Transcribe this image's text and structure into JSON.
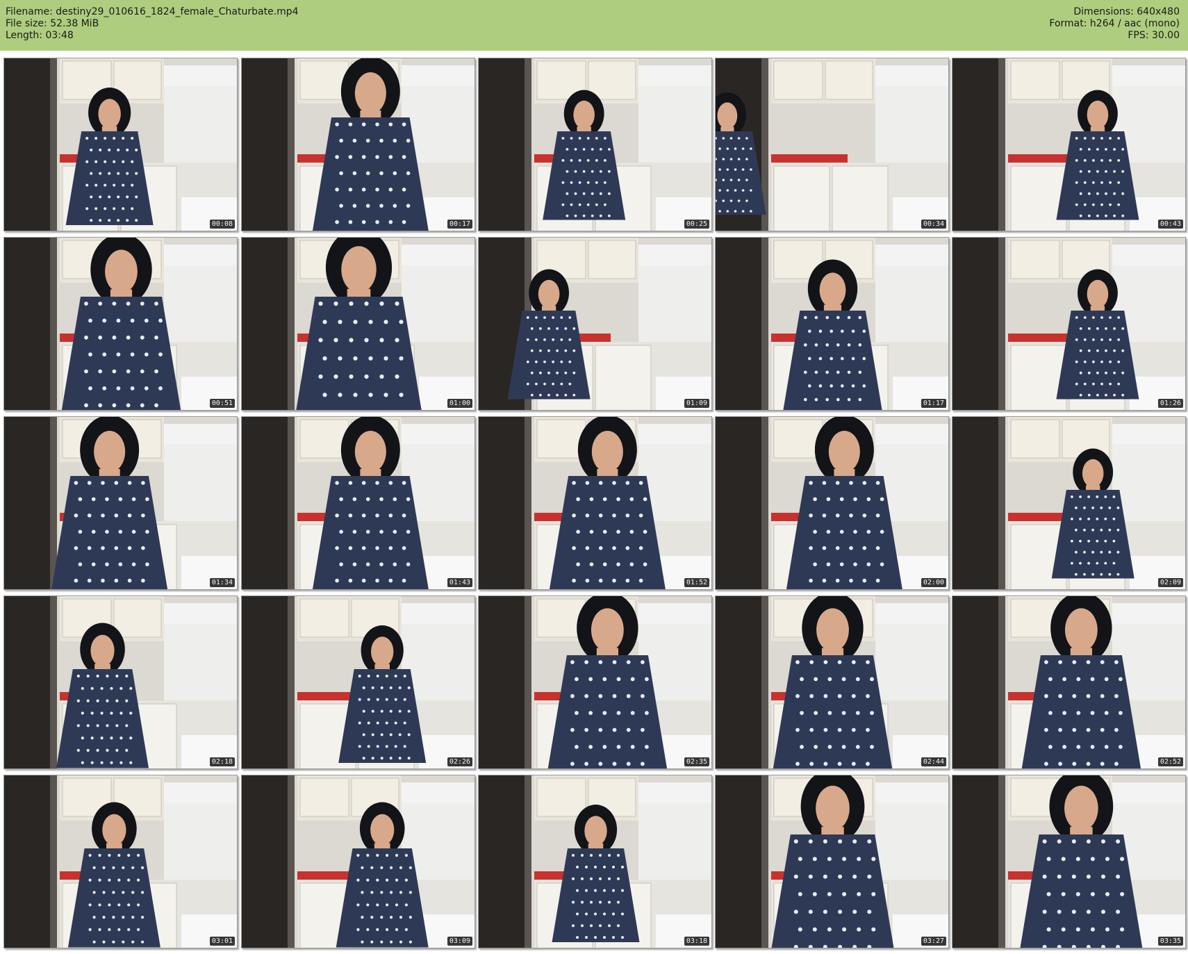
{
  "header": {
    "filename": "Filename: destiny29_010616_1824_female_Chaturbate.mp4",
    "file_size": "File size: 52.38 MiB",
    "length": "Length: 03:48",
    "dimensions": "Dimensions: 640x480",
    "format": "Format: h264 / aac (mono)",
    "fps": "FPS: 30.00"
  },
  "colors": {
    "header_bg": "#aecd7e",
    "timestamp_bg": "#000000",
    "dress": "#2e3a55"
  },
  "thumbnails": [
    {
      "time": "00:08"
    },
    {
      "time": "00:17"
    },
    {
      "time": "00:25"
    },
    {
      "time": "00:34"
    },
    {
      "time": "00:43"
    },
    {
      "time": "00:51"
    },
    {
      "time": "01:00"
    },
    {
      "time": "01:09"
    },
    {
      "time": "01:17"
    },
    {
      "time": "01:26"
    },
    {
      "time": "01:34"
    },
    {
      "time": "01:43"
    },
    {
      "time": "01:52"
    },
    {
      "time": "02:00"
    },
    {
      "time": "02:09"
    },
    {
      "time": "02:18"
    },
    {
      "time": "02:26"
    },
    {
      "time": "02:35"
    },
    {
      "time": "02:44"
    },
    {
      "time": "02:52"
    },
    {
      "time": "03:01"
    },
    {
      "time": "03:09"
    },
    {
      "time": "03:18"
    },
    {
      "time": "03:27"
    },
    {
      "time": "03:35"
    }
  ]
}
